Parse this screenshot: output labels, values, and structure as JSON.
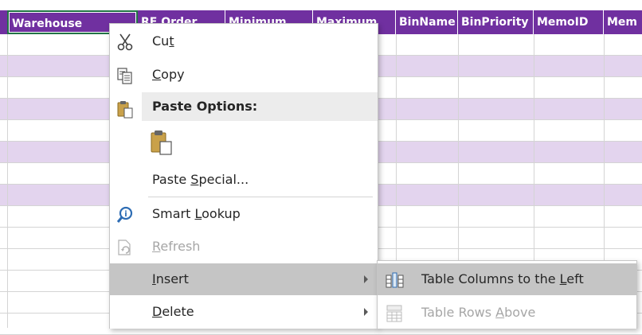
{
  "sheet": {
    "columns": [
      "Warehouse",
      "RF Order",
      "Minimum",
      "Maximum",
      "BinName",
      "BinPriority",
      "MemoID",
      "Mem"
    ],
    "header_color": "#7030a0",
    "band_color": "#e3d4ee"
  },
  "context_menu": {
    "cut": {
      "pre": "Cu",
      "key": "t",
      "post": ""
    },
    "copy": {
      "pre": "",
      "key": "C",
      "post": "opy"
    },
    "paste_options": "Paste Options:",
    "paste_special": {
      "pre": "Paste ",
      "key": "S",
      "post": "pecial..."
    },
    "smart_lookup": {
      "pre": "Smart ",
      "key": "L",
      "post": "ookup"
    },
    "refresh": {
      "pre": "",
      "key": "R",
      "post": "efresh"
    },
    "insert": {
      "pre": "",
      "key": "I",
      "post": "nsert"
    },
    "delete": {
      "pre": "",
      "key": "D",
      "post": "elete"
    }
  },
  "submenu": {
    "table_columns_left": {
      "pre": "Table Columns to the ",
      "key": "L",
      "post": "eft"
    },
    "table_rows_above": {
      "pre": "Table Rows ",
      "key": "A",
      "post": "bove"
    }
  }
}
